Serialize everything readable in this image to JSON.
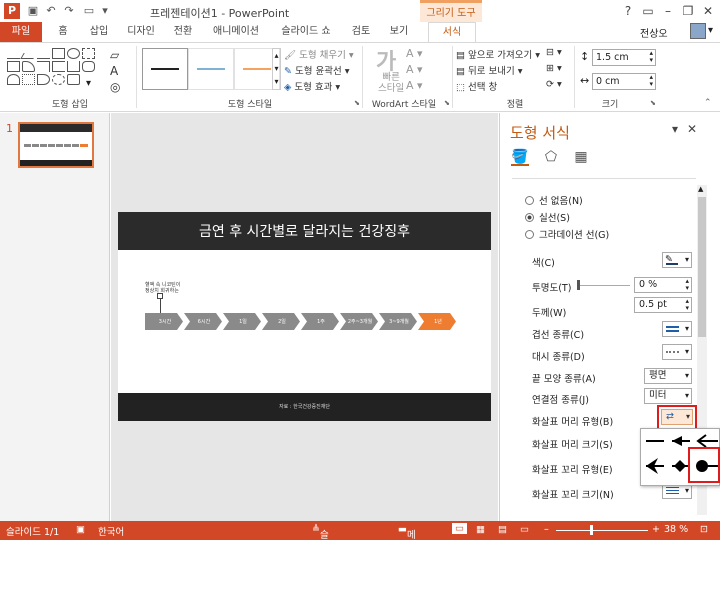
{
  "app": {
    "window_title": "프레젠테이션1 - PowerPoint",
    "context_tab_header": "그리기 도구",
    "user_name": "전상오"
  },
  "tabs": [
    "파일",
    "홈",
    "삽입",
    "디자인",
    "전환",
    "애니메이션",
    "슬라이드 쇼",
    "검토",
    "보기",
    "서식"
  ],
  "ribbon": {
    "groups": [
      "도형 삽입",
      "도형 스타일",
      "WordArt 스타일",
      "정렬",
      "크기"
    ],
    "shape_fill": "도형 채우기",
    "shape_outline": "도형 윤곽선",
    "shape_effects": "도형 효과",
    "quick_styles": "빠른\n스타일",
    "bring_forward": "앞으로 가져오기",
    "send_backward": "뒤로 보내기",
    "selection_pane": "선택 창",
    "height_value": "1.5 cm",
    "width_value": "0 cm"
  },
  "thumbnails": {
    "number": "1"
  },
  "slide": {
    "title": "금연 후 시간별로 달라지는 건강징후",
    "callout": "혈액 속 니코틴이\n정상치 회귀하는",
    "steps": [
      "3시간",
      "6시간",
      "1일",
      "2일",
      "1주",
      "2주~3개월",
      "3~9개월",
      "1년"
    ],
    "source": "자료 : 한국건강증진재단"
  },
  "format_pane": {
    "title": "도형 서식",
    "line_options": [
      "선 없음(N)",
      "실선(S)",
      "그라데이션 선(G)"
    ],
    "selected_line_option": "실선(S)",
    "properties": [
      {
        "label": "색(C)",
        "value": ""
      },
      {
        "label": "투명도(T)",
        "value": "0 %"
      },
      {
        "label": "두께(W)",
        "value": "0.5 pt"
      },
      {
        "label": "겹선 종류(C)",
        "value": ""
      },
      {
        "label": "대시 종류(D)",
        "value": ""
      },
      {
        "label": "끝 모양 종류(A)",
        "value": "평면"
      },
      {
        "label": "연결점 종류(J)",
        "value": "미터"
      },
      {
        "label": "화살표 머리 유형(B)",
        "value": ""
      },
      {
        "label": "화살표 머리 크기(S)",
        "value": ""
      },
      {
        "label": "화살표 꼬리 유형(E)",
        "value": ""
      },
      {
        "label": "화살표 꼬리 크기(N)",
        "value": ""
      }
    ]
  },
  "status": {
    "slide": "슬라이드 1/1",
    "language": "한국어",
    "notes": "슬라이드 노트",
    "comments": "메모",
    "zoom": "38 %"
  },
  "colors": {
    "accent": "#d24726",
    "format_accent": "#c55a11",
    "chevron_gray": "#8a8a8a",
    "chevron_highlight": "#ee7d31",
    "highlight_box": "#e01b1b"
  }
}
